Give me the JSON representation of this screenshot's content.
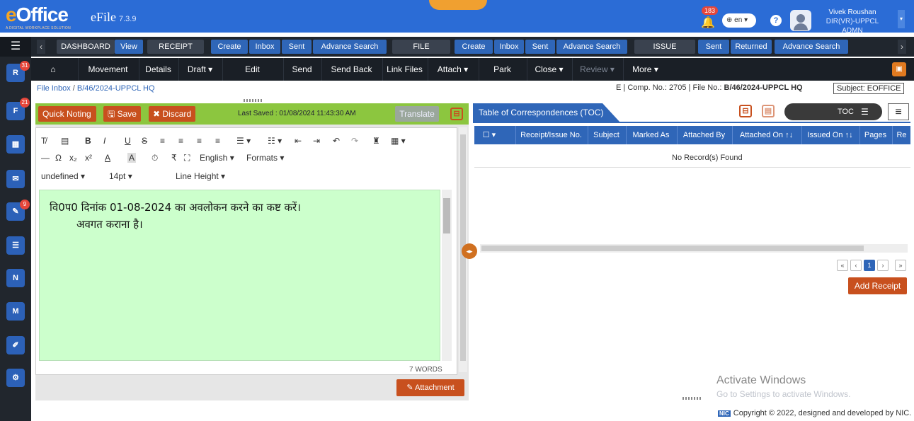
{
  "header": {
    "logo": "eOffice",
    "tagline": "A DIGITAL WORKPLACE SOLUTION",
    "app": "eFile",
    "version": "7.3.9",
    "notif_count": "183",
    "lang": "en",
    "user_name": "Vivek Roushan",
    "user_desig": "DIR(VR)-UPPCL ADMN"
  },
  "nav1": {
    "dashboard": "DASHBOARD",
    "view": "View",
    "receipt": "RECEIPT",
    "r_create": "Create",
    "r_inbox": "Inbox",
    "r_sent": "Sent",
    "r_adv": "Advance Search",
    "file": "FILE",
    "f_create": "Create",
    "f_inbox": "Inbox",
    "f_sent": "Sent",
    "f_adv": "Advance Search",
    "issue": "ISSUE",
    "i_sent": "Sent",
    "i_returned": "Returned",
    "i_adv": "Advance Search"
  },
  "nav2": {
    "movement": "Movement",
    "details": "Details",
    "draft": "Draft ▾",
    "edit": "Edit",
    "send": "Send",
    "sendback": "Send Back",
    "linkfiles": "Link Files",
    "attach": "Attach ▾",
    "park": "Park",
    "close": "Close ▾",
    "review": "Review ▾",
    "more": "More ▾"
  },
  "sidebar": {
    "badge1": "31",
    "badge2": "21",
    "badge3": "9"
  },
  "breadcrumb": {
    "root": "File Inbox",
    "sep": "/",
    "file": "B/46/2024-UPPCL HQ"
  },
  "meta": {
    "e": "E",
    "comp": "Comp. No.: 2705",
    "fileno_label": "File No.:",
    "fileno": "B/46/2024-UPPCL HQ",
    "subject": "Subject: EOFFICE"
  },
  "noting": {
    "quick": "Quick Noting",
    "save": "Save",
    "discard": "Discard",
    "last_saved": "Last Saved : 01/08/2024 11:43:30 AM",
    "translate": "Translate"
  },
  "toolbar": {
    "lang": "English",
    "formats": "Formats",
    "font": "undefined",
    "size": "14pt",
    "lineheight": "Line Height"
  },
  "editor": {
    "line1": "वि0प0 दिनांक 01-08-2024 का अवलोकन करने का कष्ट करें।",
    "line2": "अवगत कराना है।",
    "words": "7 WORDS"
  },
  "attachment": "Attachment",
  "toc": {
    "title": "Table of Correspondences (TOC)",
    "toc_label": "TOC",
    "cols": [
      "Receipt/Issue No.",
      "Subject",
      "Marked As",
      "Attached By",
      "Attached On ↑↓",
      "Issued On ↑↓",
      "Pages",
      "Re"
    ],
    "empty": "No Record(s) Found",
    "page": "1",
    "add": "Add Receipt"
  },
  "watermark": {
    "line1": "Activate Windows",
    "line2": "Go to Settings to activate Windows."
  },
  "footer": {
    "nic": "NIC",
    "text": "Copyright © 2022, designed and developed by NIC."
  }
}
